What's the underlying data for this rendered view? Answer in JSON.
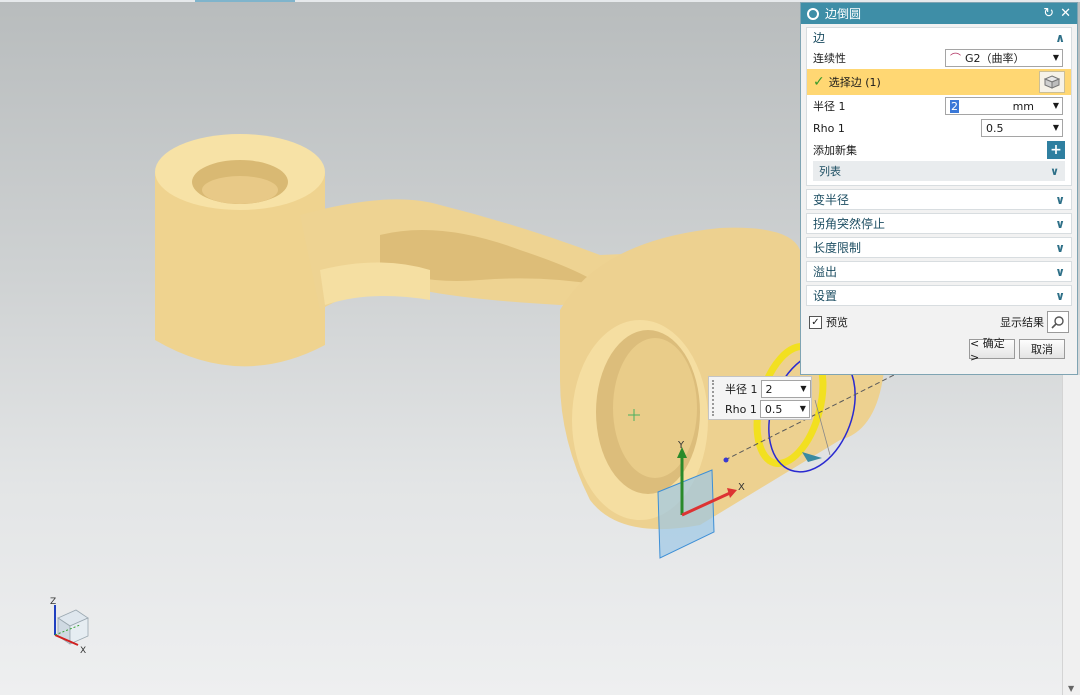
{
  "dialog": {
    "title": "边倒圆",
    "edge_section": {
      "header": "边",
      "continuity_label": "连续性",
      "continuity_value": "G2（曲率）",
      "select_edge_label": "选择边 (1)",
      "radius_label": "半径 1",
      "radius_value": "2",
      "radius_unit": "mm",
      "rho_label": "Rho 1",
      "rho_value": "0.5",
      "add_new_set_label": "添加新集",
      "list_label": "列表"
    },
    "collapsed_sections": [
      "变半径",
      "拐角突然停止",
      "长度限制",
      "溢出",
      "设置"
    ],
    "preview_label": "预览",
    "preview_checked": true,
    "show_result_label": "显示结果",
    "ok_label": "< 确定 >",
    "cancel_label": "取消"
  },
  "floating_input": {
    "radius_label": "半径 1",
    "radius_value": "2",
    "rho_label": "Rho 1",
    "rho_value": "0.5"
  },
  "triad": {
    "x": "X",
    "y": "Y",
    "z": "Z"
  },
  "colors": {
    "title_bar": "#3e8ea7",
    "selection_highlight": "#ffd773",
    "model_body": "#f2d894",
    "fillet_preview": "#f2e020",
    "viewport_top": "#b8bcbd",
    "viewport_bottom": "#eeeff0"
  }
}
